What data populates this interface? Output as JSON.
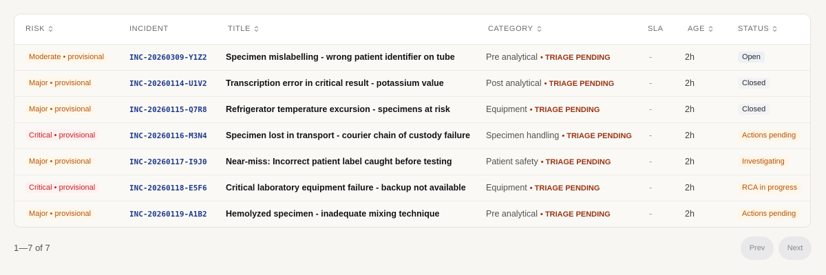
{
  "table": {
    "columns": [
      {
        "key": "risk",
        "label": "RISK",
        "sortable": true
      },
      {
        "key": "incident",
        "label": "INCIDENT",
        "sortable": false
      },
      {
        "key": "title",
        "label": "TITLE",
        "sortable": true
      },
      {
        "key": "category",
        "label": "CATEGORY",
        "sortable": true
      },
      {
        "key": "sla",
        "label": "SLA",
        "sortable": false
      },
      {
        "key": "age",
        "label": "AGE",
        "sortable": true
      },
      {
        "key": "status",
        "label": "STATUS",
        "sortable": true
      }
    ],
    "rows": [
      {
        "risk": "Moderate • provisional",
        "risk_level": "moderate",
        "incident": "INC-20260309-Y1Z2",
        "title": "Specimen mislabelling - wrong patient identifier on tube",
        "category": "Pre analytical",
        "triage": "• TRIAGE PENDING",
        "sla": "-",
        "age": "2h",
        "status": "Open",
        "status_kind": "open"
      },
      {
        "risk": "Major • provisional",
        "risk_level": "major",
        "incident": "INC-20260114-U1V2",
        "title": "Transcription error in critical result - potassium value",
        "category": "Post analytical",
        "triage": "• TRIAGE PENDING",
        "sla": "-",
        "age": "2h",
        "status": "Closed",
        "status_kind": "closed"
      },
      {
        "risk": "Major • provisional",
        "risk_level": "major",
        "incident": "INC-20260115-Q7R8",
        "title": "Refrigerator temperature excursion - specimens at risk",
        "category": "Equipment",
        "triage": "• TRIAGE PENDING",
        "sla": "-",
        "age": "2h",
        "status": "Closed",
        "status_kind": "closed"
      },
      {
        "risk": "Critical • provisional",
        "risk_level": "critical",
        "incident": "INC-20260116-M3N4",
        "title": "Specimen lost in transport - courier chain of custody failure",
        "category": "Specimen handling",
        "triage": "• TRIAGE PENDING",
        "sla": "-",
        "age": "2h",
        "status": "Actions pending",
        "status_kind": "warn"
      },
      {
        "risk": "Major • provisional",
        "risk_level": "major",
        "incident": "INC-20260117-I9J0",
        "title": "Near-miss: Incorrect patient label caught before testing",
        "category": "Patient safety",
        "triage": "• TRIAGE PENDING",
        "sla": "-",
        "age": "2h",
        "status": "Investigating",
        "status_kind": "warn"
      },
      {
        "risk": "Critical • provisional",
        "risk_level": "critical",
        "incident": "INC-20260118-E5F6",
        "title": "Critical laboratory equipment failure - backup not available",
        "category": "Equipment",
        "triage": "• TRIAGE PENDING",
        "sla": "-",
        "age": "2h",
        "status": "RCA in progress",
        "status_kind": "warn"
      },
      {
        "risk": "Major • provisional",
        "risk_level": "major",
        "incident": "INC-20260119-A1B2",
        "title": "Hemolyzed specimen - inadequate mixing technique",
        "category": "Pre analytical",
        "triage": "• TRIAGE PENDING",
        "sla": "-",
        "age": "2h",
        "status": "Actions pending",
        "status_kind": "warn"
      }
    ]
  },
  "pagination": {
    "range_label": "1—7 of 7",
    "prev_label": "Prev",
    "next_label": "Next"
  },
  "icons": {
    "sort": "sort-icon"
  },
  "colors": {
    "background": "#f8f6f2",
    "risk_moderate": "#b45309",
    "risk_major": "#b45309",
    "risk_critical": "#c81e1e",
    "incident_link": "#1e3a8a",
    "triage": "#9a3412",
    "status_warn": "#b45309"
  }
}
